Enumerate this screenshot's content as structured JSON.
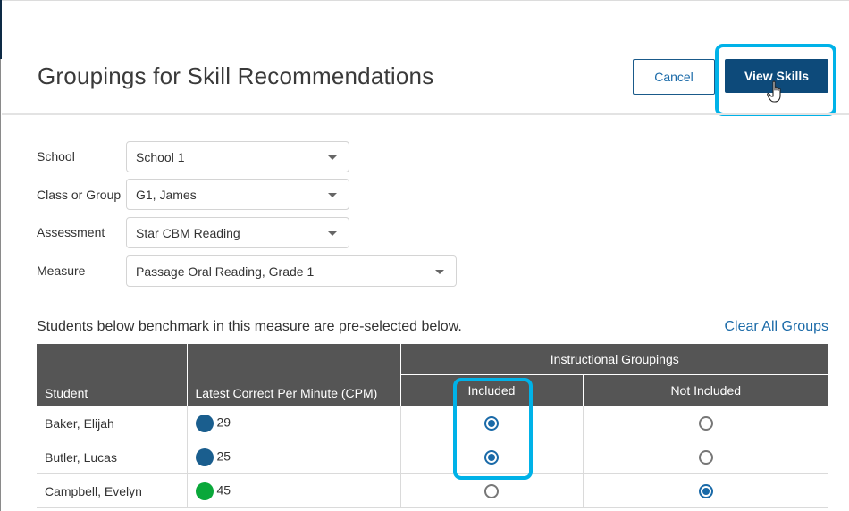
{
  "header": {
    "title": "Groupings for Skill Recommendations",
    "cancel_label": "Cancel",
    "view_skills_label": "View Skills"
  },
  "form": {
    "school": {
      "label": "School",
      "value": "School 1"
    },
    "class_or_group": {
      "label": "Class or Group",
      "value": "G1, James"
    },
    "assessment": {
      "label": "Assessment",
      "value": "Star CBM Reading"
    },
    "measure": {
      "label": "Measure",
      "value": "Passage Oral Reading, Grade 1"
    }
  },
  "note": "Students below benchmark in this measure are pre-selected below.",
  "clear_all_label": "Clear All Groups",
  "table": {
    "headers": {
      "student": "Student",
      "cpm": "Latest Correct Per Minute (CPM)",
      "groupings": "Instructional Groupings",
      "included": "Included",
      "not_included": "Not Included"
    },
    "rows": [
      {
        "student": "Baker, Elijah",
        "cpm": "29",
        "status_color": "#1a5e8e",
        "included": true
      },
      {
        "student": "Butler, Lucas",
        "cpm": "25",
        "status_color": "#1a5e8e",
        "included": true
      },
      {
        "student": "Campbell, Evelyn",
        "cpm": "45",
        "status_color": "#0aa83a",
        "included": false
      }
    ]
  },
  "colors": {
    "primary": "#0d4a7a",
    "link": "#1a6aa8",
    "highlight": "#00b2e8",
    "header_bg": "#555555"
  }
}
